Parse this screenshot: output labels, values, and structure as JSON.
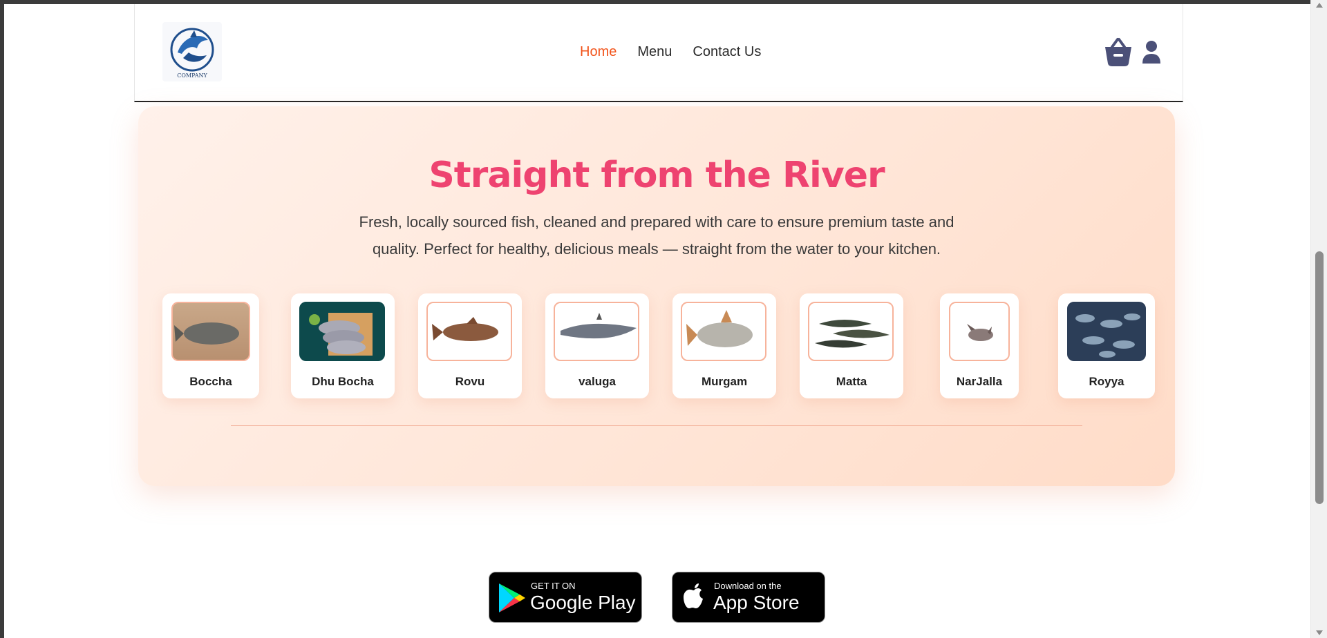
{
  "header": {
    "logo_text": "COMPANY",
    "nav": [
      {
        "label": "Home",
        "active": true
      },
      {
        "label": "Menu",
        "active": false
      },
      {
        "label": "Contact Us",
        "active": false
      }
    ],
    "icons": {
      "cart": "basket-icon",
      "account": "user-icon"
    },
    "colors": {
      "active": "#f2541b",
      "icon": "#4b5078"
    }
  },
  "hero": {
    "title": "Straight from the River",
    "description": "Fresh, locally sourced fish, cleaned and prepared with care to ensure premium taste and quality. Perfect for healthy, delicious meals — straight from the water to your kitchen.",
    "title_color": "#ee4370",
    "fish": [
      {
        "name": "Boccha"
      },
      {
        "name": "Dhu Bocha"
      },
      {
        "name": "Rovu"
      },
      {
        "name": "valuga"
      },
      {
        "name": "Murgam"
      },
      {
        "name": "Matta"
      },
      {
        "name": "NarJalla"
      },
      {
        "name": "Royya"
      }
    ]
  },
  "stores": {
    "google": {
      "small": "GET IT ON",
      "big": "Google Play"
    },
    "apple": {
      "small": "Download on the",
      "big": "App Store"
    }
  }
}
